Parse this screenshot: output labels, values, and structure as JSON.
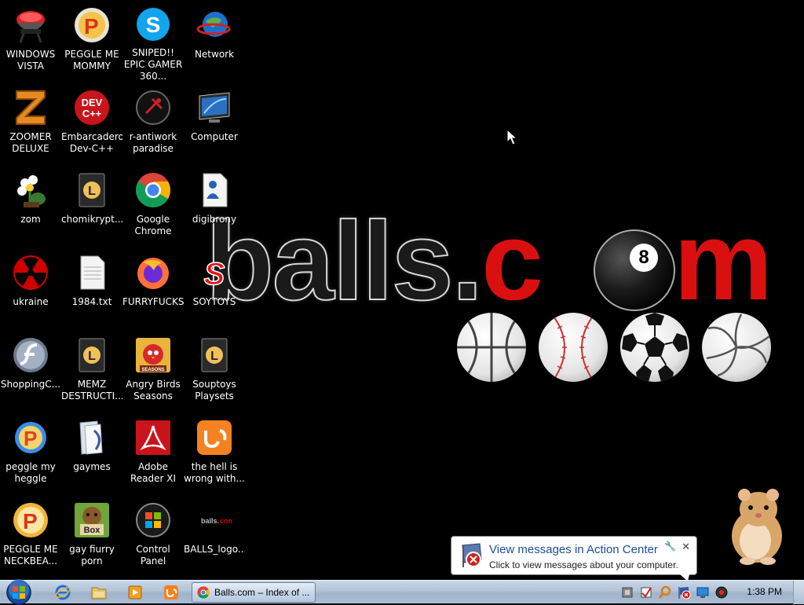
{
  "wallpaper": {
    "text_dark": "balls.",
    "text_red_c": "c",
    "text_m": "m",
    "balls": [
      "basketball",
      "baseball",
      "soccer-ball",
      "volleyball"
    ]
  },
  "desktop_icons": [
    {
      "label": "WINDOWS VISTA",
      "icon": "grill-icon"
    },
    {
      "label": "PEGGLE ME MOMMY",
      "icon": "peggle-icon"
    },
    {
      "label": "SNIPED!! EPIC GAMER 360...",
      "icon": "skype-icon"
    },
    {
      "label": "Network",
      "icon": "network-globe-icon"
    },
    {
      "label": "ZOOMER DELUXE",
      "icon": "zuma-icon"
    },
    {
      "label": "Embarcadero Dev-C++",
      "icon": "devcpp-icon"
    },
    {
      "label": "r-antiwork paradise",
      "icon": "antiwork-icon"
    },
    {
      "label": "Computer",
      "icon": "computer-icon"
    },
    {
      "label": "zom",
      "icon": "plant-zombie-icon"
    },
    {
      "label": "chomikrypt...",
      "icon": "shortcut-l-icon"
    },
    {
      "label": "Google Chrome",
      "icon": "chrome-icon"
    },
    {
      "label": "digibrony",
      "icon": "document-user-icon"
    },
    {
      "label": "ukraine",
      "icon": "radiation-icon"
    },
    {
      "label": "1984.txt",
      "icon": "text-file-icon"
    },
    {
      "label": "FURRYFUCKS",
      "icon": "firefox-icon"
    },
    {
      "label": "SOYTOYS",
      "icon": "soytoys-s-icon"
    },
    {
      "label": "ShoppingC...",
      "icon": "flash-icon"
    },
    {
      "label": "MEMZ DESTRUCTI...",
      "icon": "shortcut-l-icon"
    },
    {
      "label": "Angry Birds Seasons",
      "icon": "angry-birds-icon"
    },
    {
      "label": "Souptoys Playsets",
      "icon": "shortcut-l-icon"
    },
    {
      "label": "peggle my heggle",
      "icon": "peggle-icon"
    },
    {
      "label": "gaymes",
      "icon": "folder-icon"
    },
    {
      "label": "Adobe Reader XI",
      "icon": "adobe-reader-icon"
    },
    {
      "label": "the hell is wrong with...",
      "icon": "uc-browser-icon"
    },
    {
      "label": "PEGGLE ME NECKBEA...",
      "icon": "peggle-icon"
    },
    {
      "label": "gay fiurry porn",
      "icon": "beaver-box-icon"
    },
    {
      "label": "Control Panel",
      "icon": "control-panel-icon"
    },
    {
      "label": "BALLS_logo...",
      "icon": "image-file-icon"
    }
  ],
  "balloon": {
    "title": "View messages in Action Center",
    "text": "Click to view messages about your computer.",
    "close": "✕",
    "settings": "🔧"
  },
  "taskbar": {
    "pinned": [
      "internet-explorer-icon",
      "explorer-folder-icon",
      "media-player-icon",
      "uc-browser-icon"
    ],
    "task_label": "Balls.com – Index of ...",
    "tray": [
      "usb-icon",
      "checkbox-icon",
      "search-tray-icon",
      "action-center-flag-icon",
      "network-tray-icon",
      "volume-tray-icon"
    ],
    "clock": "1:38 PM"
  }
}
